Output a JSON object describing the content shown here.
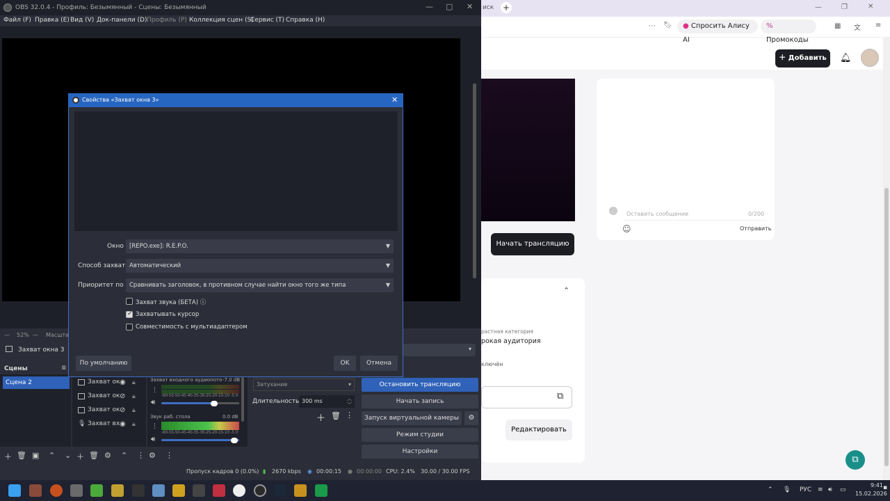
{
  "browser": {
    "tab_text": "иск",
    "plus": "+",
    "alice_label": "Спросить Алису AI",
    "promo_label": "Промокоды",
    "add_label": "Добавить",
    "chat_placeholder": "Оставить сообщение",
    "chat_counter": "0/200",
    "send_label": "Отправить",
    "start_stream_label": "Начать трансляцию",
    "category_label": "растная категория",
    "audience_label": "рокая аудитория",
    "off_label": "ключён",
    "edit_label": "Редактировать",
    "colors": {
      "accent_dark": "#1d1d24",
      "fab": "#1a8f8a"
    }
  },
  "obs": {
    "title": "OBS 32.0.4 - Профиль: Безымянный - Сцены: Безымянный",
    "menu": [
      {
        "label": "Файл (F)"
      },
      {
        "label": "Правка (E)"
      },
      {
        "label": "Вид (V)"
      },
      {
        "label": "Док-панели (D)"
      },
      {
        "label": "Профиль (P)"
      },
      {
        "label": "Коллекция сцен (S)"
      },
      {
        "label": "Сервис (T)"
      },
      {
        "label": "Справка (H)"
      }
    ],
    "zoom": "52%",
    "zoom_label": "Масшта",
    "selected_source": "Захват окна 3",
    "scenes_header": "Сцены",
    "scene_selected": "Сцена 2",
    "sources": [
      {
        "label": "Захват ок"
      },
      {
        "label": "Захват ок"
      },
      {
        "label": "Захват ок"
      },
      {
        "label": "Захват вх"
      }
    ],
    "mixer": [
      {
        "name": "Захват входного аудиопото",
        "db": "-7.0 dB"
      },
      {
        "name": "Звук раб. стола",
        "db": "0.0 dB"
      }
    ],
    "meter_ticks": "-60-55-50-45-40-35-30-25-20-15-10 -5 0",
    "transition": "Затухание",
    "duration_label": "Длительность",
    "duration_value": "300 ms",
    "controls": {
      "stop_stream": "Остановить трансляцию",
      "start_record": "Начать запись",
      "virtual_cam": "Запуск виртуальной камеры",
      "studio_mode": "Режим студии",
      "settings": "Настройки"
    },
    "status": {
      "dropped": "Пропуск кадров 0 (0.0%)",
      "bitrate": "2670 kbps",
      "stream_time": "00:00:15",
      "rec_time": "00:00:00",
      "cpu": "CPU: 2.4%",
      "fps": "30.00 / 30.00 FPS"
    }
  },
  "dialog": {
    "title": "Свойства «Захват окна 3»",
    "window_label": "Окно",
    "window_value": "[REPO.exe]: R.E.P.O.",
    "method_label": "Способ захвата",
    "method_value": "Автоматический",
    "priority_label": "Приоритет поді",
    "priority_value": "Сравнивать заголовок, в противном случае найти окно того же типа",
    "chk_audio": "Захват звука (БЕТА)",
    "chk_cursor": "Захватывать курсор",
    "chk_multi": "Совместимость с мультиадаптером",
    "defaults_label": "По умолчанию",
    "ok_label": "OK",
    "cancel_label": "Отмена"
  },
  "taskbar": {
    "lang": "РУС",
    "time": "9:41",
    "date": "15.02.2026"
  }
}
